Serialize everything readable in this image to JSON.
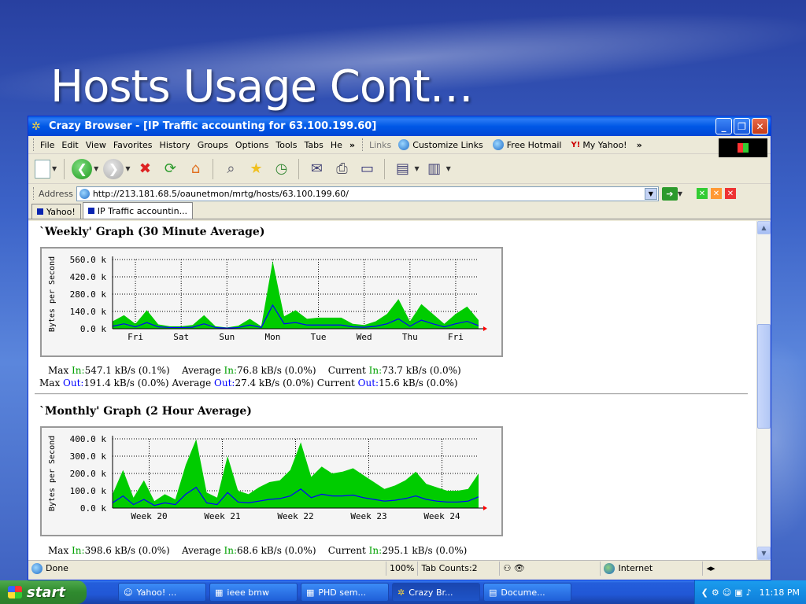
{
  "slide": {
    "title": "Hosts Usage Cont…"
  },
  "window": {
    "title": "Crazy Browser - [IP Traffic accounting for 63.100.199.60]",
    "controls": {
      "minimize": "_",
      "restore": "❐",
      "close": "✕"
    }
  },
  "menu": {
    "items": [
      "File",
      "Edit",
      "View",
      "Favorites",
      "History",
      "Groups",
      "Options",
      "Tools",
      "Tabs",
      "He"
    ],
    "more": "»",
    "links_label": "Links",
    "links": [
      "Customize Links",
      "Free Hotmail",
      "My Yahoo!"
    ],
    "links_more": "»"
  },
  "address": {
    "label": "Address",
    "url": "http://213.181.68.5/oaunetmon/mrtg/hosts/63.100.199.60/"
  },
  "tabs": [
    {
      "label": "Yahoo!"
    },
    {
      "label": "IP Traffic accountin..."
    }
  ],
  "weekly": {
    "title": "`Weekly' Graph (30 Minute Average)",
    "stats_in": {
      "max_label": "Max",
      "in": "In:",
      "max_val": "547.1 kB/s (0.1%)",
      "avg_label": "Average",
      "avg_val": "76.8 kB/s (0.0%)",
      "cur_label": "Current",
      "cur_val": "73.7 kB/s (0.0%)"
    },
    "stats_out": {
      "max_label": "Max",
      "out": "Out:",
      "max_val": "191.4 kB/s (0.0%)",
      "avg_label": "Average",
      "avg_val": "27.4 kB/s (0.0%)",
      "cur_label": "Current",
      "cur_val": "15.6 kB/s (0.0%)"
    }
  },
  "monthly": {
    "title": "`Monthly' Graph (2 Hour Average)",
    "stats_in": {
      "max_label": "Max",
      "in": "In:",
      "max_val": "398.6 kB/s (0.0%)",
      "avg_label": "Average",
      "avg_val": "68.6 kB/s (0.0%)",
      "cur_label": "Current",
      "cur_val": "295.1 kB/s (0.0%)"
    }
  },
  "chart_data": [
    {
      "type": "area",
      "title": "",
      "ylabel": "Bytes per Second",
      "yticks": [
        "0.0 k",
        "140.0 k",
        "280.0 k",
        "420.0 k",
        "560.0 k"
      ],
      "ylim": [
        0,
        560
      ],
      "xticks": [
        "Fri",
        "Sat",
        "Sun",
        "Mon",
        "Tue",
        "Wed",
        "Thu",
        "Fri"
      ],
      "x": [
        0,
        0.5,
        1,
        1.5,
        2,
        2.5,
        3,
        3.5,
        4,
        4.5,
        5,
        5.5,
        6,
        6.5,
        7,
        7.5,
        8,
        8.5,
        9,
        9.5,
        10,
        10.5,
        11,
        11.5,
        12,
        12.5,
        13,
        13.5,
        14,
        14.5,
        15,
        15.5,
        16
      ],
      "series": [
        {
          "name": "In",
          "color": "#00cc00",
          "values": [
            60,
            110,
            40,
            150,
            35,
            20,
            20,
            30,
            110,
            20,
            10,
            25,
            80,
            20,
            547,
            100,
            150,
            80,
            90,
            90,
            90,
            40,
            30,
            60,
            120,
            240,
            60,
            200,
            120,
            40,
            120,
            180,
            70
          ]
        },
        {
          "name": "Out",
          "color": "#0000ff",
          "values": [
            20,
            40,
            15,
            50,
            15,
            10,
            10,
            12,
            40,
            10,
            5,
            10,
            30,
            10,
            191,
            40,
            50,
            30,
            30,
            30,
            30,
            15,
            12,
            20,
            40,
            80,
            20,
            70,
            40,
            15,
            40,
            60,
            25
          ]
        }
      ],
      "grid": true
    },
    {
      "type": "area",
      "title": "",
      "ylabel": "Bytes per Second",
      "yticks": [
        "0.0 k",
        "100.0 k",
        "200.0 k",
        "300.0 k",
        "400.0 k"
      ],
      "ylim": [
        0,
        400
      ],
      "xticks": [
        "Week 20",
        "Week 21",
        "Week 22",
        "Week 23",
        "Week 24"
      ],
      "x": [
        0,
        1,
        2,
        3,
        4,
        5,
        6,
        7,
        8,
        9,
        10,
        11,
        12,
        13,
        14,
        15,
        16,
        17,
        18,
        19,
        20,
        21,
        22,
        23,
        24,
        25,
        26,
        27,
        28,
        29,
        30,
        31,
        32,
        33,
        34,
        35
      ],
      "series": [
        {
          "name": "In",
          "color": "#00cc00",
          "values": [
            80,
            220,
            60,
            160,
            40,
            80,
            50,
            250,
            398,
            90,
            60,
            300,
            100,
            80,
            120,
            150,
            160,
            220,
            380,
            180,
            240,
            200,
            210,
            230,
            190,
            150,
            110,
            130,
            160,
            210,
            140,
            120,
            100,
            100,
            110,
            200
          ]
        },
        {
          "name": "Out",
          "color": "#0000ff",
          "values": [
            30,
            70,
            20,
            50,
            15,
            30,
            20,
            80,
            120,
            30,
            20,
            90,
            35,
            30,
            40,
            50,
            55,
            70,
            110,
            60,
            80,
            70,
            70,
            75,
            60,
            50,
            40,
            45,
            55,
            70,
            50,
            40,
            35,
            35,
            40,
            65
          ]
        }
      ],
      "grid": true
    }
  ],
  "status": {
    "text": "Done",
    "zoom": "100%",
    "tab_counts": "Tab Counts:2",
    "zone": "Internet"
  },
  "taskbar": {
    "start": "start",
    "buttons": [
      "Yahoo! ...",
      "ieee bmw",
      "PHD sem...",
      "Crazy Br...",
      "Docume..."
    ],
    "clock": "11:18 PM"
  }
}
